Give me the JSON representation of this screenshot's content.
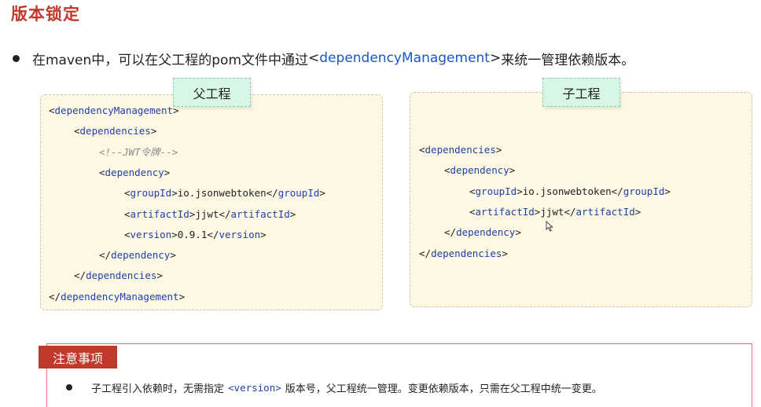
{
  "title": "版本锁定",
  "bullet": {
    "prefix": "在maven中，可以在父工程的pom文件中通过 ",
    "tag_open": "<",
    "keyword": "dependencyManagement",
    "tag_close": ">",
    "suffix": " 来统一管理依赖版本。"
  },
  "parent": {
    "tab_label": "父工程",
    "lines": [
      {
        "open": "<",
        "tag": "dependencyManagement",
        "close": ">",
        "text": "",
        "end_open": "",
        "end_tag": "",
        "end_close": ""
      },
      {
        "open": "<",
        "tag": "dependencies",
        "close": ">",
        "text": "",
        "end_open": "",
        "end_tag": "",
        "end_close": ""
      },
      {
        "comment": "<!--JWT令牌-->"
      },
      {
        "open": "<",
        "tag": "dependency",
        "close": ">",
        "text": "",
        "end_open": "",
        "end_tag": "",
        "end_close": ""
      },
      {
        "open": "<",
        "tag": "groupId",
        "close": ">",
        "text": "io.jsonwebtoken",
        "end_open": "</",
        "end_tag": "groupId",
        "end_close": ">"
      },
      {
        "open": "<",
        "tag": "artifactId",
        "close": ">",
        "text": "jjwt",
        "end_open": "</",
        "end_tag": "artifactId",
        "end_close": ">"
      },
      {
        "open": "<",
        "tag": "version",
        "close": ">",
        "text": "0.9.1",
        "end_open": "</",
        "end_tag": "version",
        "end_close": ">"
      },
      {
        "open": "</",
        "tag": "dependency",
        "close": ">",
        "text": "",
        "end_open": "",
        "end_tag": "",
        "end_close": ""
      },
      {
        "open": "</",
        "tag": "dependencies",
        "close": ">",
        "text": "",
        "end_open": "",
        "end_tag": "",
        "end_close": ""
      },
      {
        "open": "</",
        "tag": "dependencyManagement",
        "close": ">",
        "text": "",
        "end_open": "",
        "end_tag": "",
        "end_close": ""
      }
    ]
  },
  "child": {
    "tab_label": "子工程",
    "lines": [
      {
        "open": "<",
        "tag": "dependencies",
        "close": ">",
        "text": "",
        "end_open": "",
        "end_tag": "",
        "end_close": ""
      },
      {
        "open": "<",
        "tag": "dependency",
        "close": ">",
        "text": "",
        "end_open": "",
        "end_tag": "",
        "end_close": ""
      },
      {
        "open": "<",
        "tag": "groupId",
        "close": ">",
        "text": "io.jsonwebtoken",
        "end_open": "</",
        "end_tag": "groupId",
        "end_close": ">"
      },
      {
        "open": "<",
        "tag": "artifactId",
        "close": ">",
        "text": "jjwt",
        "end_open": "</",
        "end_tag": "artifactId",
        "end_close": ">"
      },
      {
        "open": "</",
        "tag": "dependency",
        "close": ">",
        "text": "",
        "end_open": "",
        "end_tag": "",
        "end_close": ""
      },
      {
        "open": "</",
        "tag": "dependencies",
        "close": ">",
        "text": "",
        "end_open": "",
        "end_tag": "",
        "end_close": ""
      }
    ]
  },
  "notice": {
    "badge": "注意事项",
    "prefix": "子工程引入依赖时，无需指定",
    "code": "<version>",
    "suffix": "版本号，父工程统一管理。变更依赖版本，只需在父工程中统一变更。"
  },
  "colors": {
    "title": "#c0392b",
    "tag": "#1f3fa8",
    "code_bg": "#fdf8e3",
    "tab_bg": "#d7f6e5",
    "badge_bg": "#c0392b"
  },
  "icons": {
    "cursor": "mouse-pointer-icon"
  }
}
